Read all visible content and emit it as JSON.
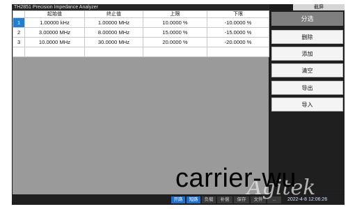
{
  "window": {
    "title": "TH2851 Precision Impedance Analyzer",
    "screenshot_label": "截屏"
  },
  "table": {
    "headers": [
      "",
      "起始值",
      "终止值",
      "上限",
      "下限"
    ],
    "rows": [
      {
        "index": "1",
        "start": "1.00000 kHz",
        "stop": "1.00000 MHz",
        "upper": "10.0000 %",
        "lower": "-10.0000 %"
      },
      {
        "index": "2",
        "start": "3.00000 MHz",
        "stop": "8.00000 MHz",
        "upper": "15.0000 %",
        "lower": "-15.0000 %"
      },
      {
        "index": "3",
        "start": "10.0000 MHz",
        "stop": "30.0000 MHz",
        "upper": "20.0000 %",
        "lower": "-20.0000 %"
      }
    ],
    "selected_index": "1"
  },
  "sidebar": {
    "title": "分选",
    "buttons": [
      "删除",
      "添加",
      "清空",
      "导出",
      "导入"
    ]
  },
  "statusbar": {
    "tabs": [
      "开路",
      "短路",
      "负载",
      "补偿",
      "保存",
      "文件",
      "..."
    ],
    "active_tabs": [
      "开路",
      "短路"
    ],
    "datetime": "2022-4-8 12:06:26"
  },
  "overlay": {
    "watermark_text": "carrier-wu",
    "logo_text": "Agitek"
  },
  "colors": {
    "accent": "#1e7fd6",
    "background": "#9a9a9a",
    "panel": "#1f1f1f"
  }
}
